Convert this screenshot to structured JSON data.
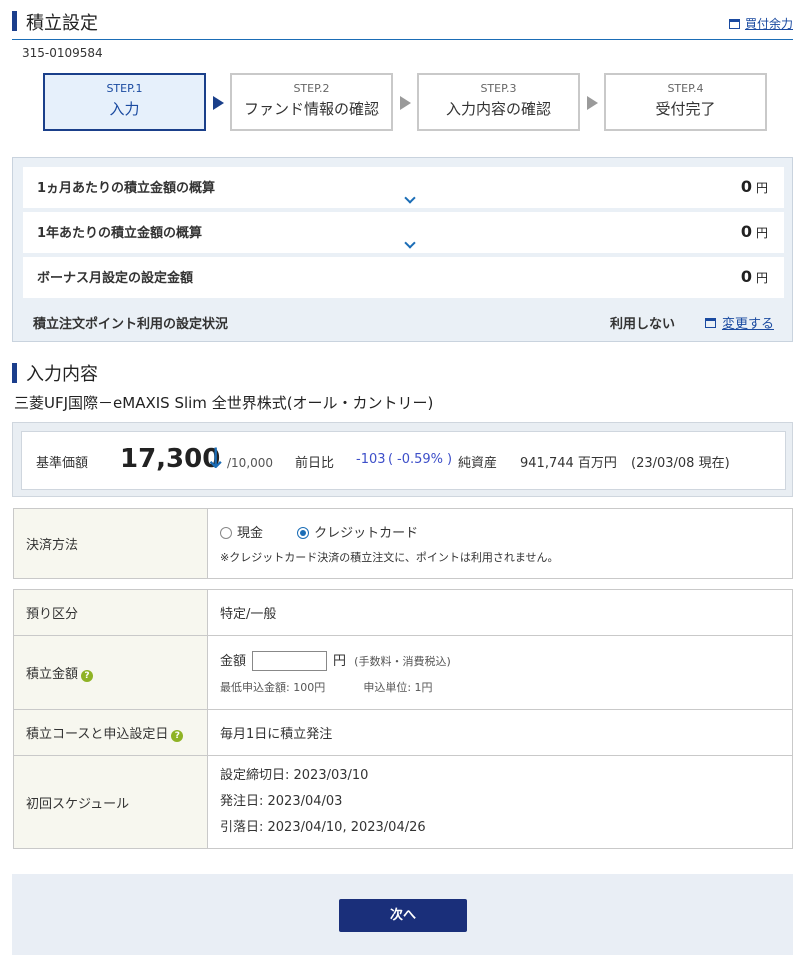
{
  "header": {
    "title": "積立設定",
    "link_label": "買付余力",
    "icon": "window-icon"
  },
  "account_number": "315-0109584",
  "steps": [
    {
      "num": "STEP.1",
      "label": "入力",
      "active": true
    },
    {
      "num": "STEP.2",
      "label": "ファンド情報の確認",
      "active": false
    },
    {
      "num": "STEP.3",
      "label": "入力内容の確認",
      "active": false
    },
    {
      "num": "STEP.4",
      "label": "受付完了",
      "active": false
    }
  ],
  "summary": {
    "monthly": {
      "label": "1ヵ月あたりの積立金額の概算",
      "value": "0",
      "unit": "円"
    },
    "yearly": {
      "label": "1年あたりの積立金額の概算",
      "value": "0",
      "unit": "円"
    },
    "bonus": {
      "label": "ボーナス月設定の設定金額",
      "value": "0",
      "unit": "円"
    },
    "point": {
      "label": "積立注文ポイント利用の設定状況",
      "status": "利用しない",
      "link_label": "変更する"
    }
  },
  "input_section": {
    "title": "入力内容"
  },
  "fund": {
    "name": "三菱UFJ国際－eMAXIS Slim 全世界株式(オール・カントリー)"
  },
  "price": {
    "label": "基準価額",
    "value": "17,300",
    "trend": "down",
    "unit": "/10,000",
    "change_label": "前日比",
    "change": "-103",
    "change_pct": "-0.59%",
    "paren_open": "(",
    "paren_close": ")",
    "net_assets_label": "純資産",
    "net_assets": "941,744 百万円",
    "as_of": "(23/03/08 現在)"
  },
  "payment": {
    "label": "決済方法",
    "options": [
      "現金",
      "クレジットカード"
    ],
    "selected": "クレジットカード",
    "note": "※クレジットカード決済の積立注文に、ポイントは利用されません。"
  },
  "rows": {
    "custody": {
      "label": "預り区分",
      "value": "特定/一般"
    },
    "amount": {
      "label": "積立金額",
      "prefix": "金額",
      "input_value": "",
      "unit": "円",
      "unit_note": "(手数料・消費税込)",
      "min": "最低申込金額: 100円",
      "step": "申込単位: 1円"
    },
    "course": {
      "label": "積立コースと申込設定日",
      "value": "毎月1日に積立発注"
    },
    "schedule": {
      "label": "初回スケジュール",
      "lines": [
        "設定締切日: 2023/03/10",
        "発注日: 2023/04/03",
        "引落日: 2023/04/10, 2023/04/26"
      ]
    }
  },
  "help_mark": "?",
  "next_button": {
    "label": "次へ"
  },
  "colors": {
    "accent": "#1b6db6",
    "navy": "#1a2f7a",
    "change": "#3d4fc9"
  }
}
